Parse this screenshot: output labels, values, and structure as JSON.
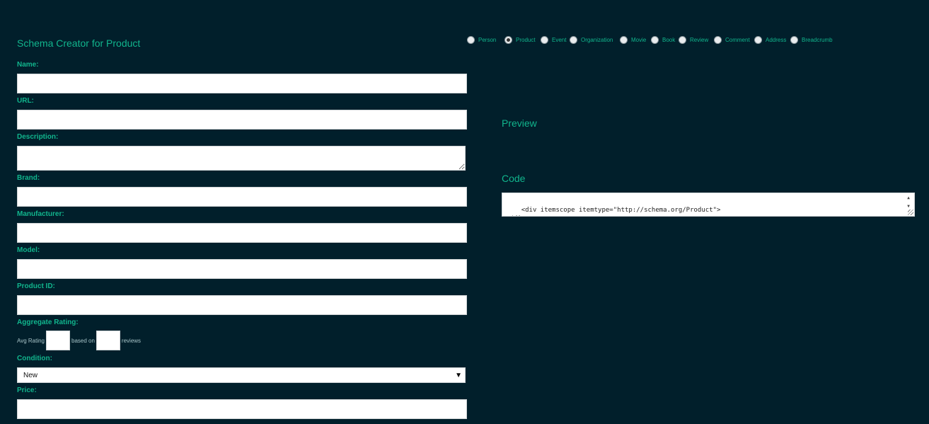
{
  "form": {
    "title": "Schema Creator for Product",
    "labels": {
      "name": "Name:",
      "url": "URL:",
      "description": "Description:",
      "brand": "Brand:",
      "manufacturer": "Manufacturer:",
      "model": "Model:",
      "product_id": "Product ID:",
      "aggregate_rating": "Aggregate Rating:",
      "condition": "Condition:",
      "price": "Price:"
    },
    "rating": {
      "avg_label": "Avg Rating",
      "based_on": "based on",
      "reviews": "reviews"
    },
    "condition_value": "New"
  },
  "schema_types": [
    "Person",
    "Product",
    "Event",
    "Organization",
    "Movie",
    "Book",
    "Review",
    "Comment",
    "Address",
    "Breadcrumb"
  ],
  "selected_type": "Product",
  "preview": {
    "title": "Preview"
  },
  "code": {
    "title": "Code",
    "content": "<div itemscope itemtype=\"http://schema.org/Product\">\n</div>"
  },
  "colors": {
    "background": "#011f2b",
    "accent": "#11b58d"
  }
}
